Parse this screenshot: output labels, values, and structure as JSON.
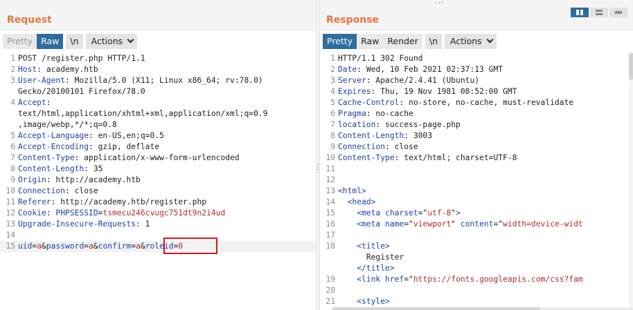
{
  "request": {
    "title": "Request",
    "tabs": {
      "pretty": "Pretty",
      "raw": "Raw",
      "newline": "\\n",
      "actions": "Actions"
    },
    "lines": [
      {
        "n": "1",
        "parts": [
          [
            "POST /register.php HTTP/1.1",
            "plain"
          ]
        ]
      },
      {
        "n": "2",
        "parts": [
          [
            "Host",
            "hk"
          ],
          [
            ": academy.htb",
            "plain"
          ]
        ]
      },
      {
        "n": "3",
        "parts": [
          [
            "User-Agent",
            "hk"
          ],
          [
            ": Mozilla/5.0 (X11; Linux x86_64; rv:78.0)",
            "plain"
          ]
        ]
      },
      {
        "n": "",
        "parts": [
          [
            "Gecko/20100101 Firefox/78.0",
            "plain"
          ]
        ]
      },
      {
        "n": "4",
        "parts": [
          [
            "Accept",
            "hk"
          ],
          [
            ":",
            "plain"
          ]
        ]
      },
      {
        "n": "",
        "parts": [
          [
            "text/html,application/xhtml+xml,application/xml;q=0.9",
            "plain"
          ]
        ]
      },
      {
        "n": "",
        "parts": [
          [
            ",image/webp,*/*;q=0.8",
            "plain"
          ]
        ]
      },
      {
        "n": "5",
        "parts": [
          [
            "Accept-Language",
            "hk"
          ],
          [
            ": en-US,en;q=0.5",
            "plain"
          ]
        ]
      },
      {
        "n": "6",
        "parts": [
          [
            "Accept-Encoding",
            "hk"
          ],
          [
            ": gzip, deflate",
            "plain"
          ]
        ]
      },
      {
        "n": "7",
        "parts": [
          [
            "Content-Type",
            "hk"
          ],
          [
            ": application/x-www-form-urlencoded",
            "plain"
          ]
        ]
      },
      {
        "n": "8",
        "parts": [
          [
            "Content-Length",
            "hk"
          ],
          [
            ": 35",
            "plain"
          ]
        ]
      },
      {
        "n": "9",
        "parts": [
          [
            "Origin",
            "hk"
          ],
          [
            ": http://academy.htb",
            "plain"
          ]
        ]
      },
      {
        "n": "10",
        "parts": [
          [
            "Connection",
            "hk"
          ],
          [
            ": close",
            "plain"
          ]
        ]
      },
      {
        "n": "11",
        "parts": [
          [
            "Referer",
            "hk"
          ],
          [
            ": http://academy.htb/register.php",
            "plain"
          ]
        ]
      },
      {
        "n": "12",
        "parts": [
          [
            "Cookie",
            "hk"
          ],
          [
            ": ",
            "plain"
          ],
          [
            "PHPSESSID",
            "ck"
          ],
          [
            "=",
            "plain"
          ],
          [
            "tsmecu246cvugc751dt9n2i4ud",
            "cv"
          ]
        ]
      },
      {
        "n": "13",
        "parts": [
          [
            "Upgrade-Insecure-Requests",
            "hk"
          ],
          [
            ": 1",
            "plain"
          ]
        ]
      },
      {
        "n": "14",
        "parts": []
      },
      {
        "n": "15",
        "parts": [
          [
            "uid",
            "ck"
          ],
          [
            "=",
            "plain"
          ],
          [
            "a",
            "cv"
          ],
          [
            "&",
            "plain"
          ],
          [
            "password",
            "ck"
          ],
          [
            "=",
            "plain"
          ],
          [
            "a",
            "cv"
          ],
          [
            "&",
            "plain"
          ],
          [
            "confirm",
            "ck"
          ],
          [
            "=",
            "plain"
          ],
          [
            "a",
            "cv"
          ],
          [
            "&",
            "plain"
          ],
          [
            "roleid",
            "ck"
          ],
          [
            "=",
            "plain"
          ],
          [
            "0",
            "cv"
          ]
        ],
        "highlight": true
      }
    ]
  },
  "response": {
    "title": "Response",
    "tabs": {
      "pretty": "Pretty",
      "raw": "Raw",
      "render": "Render",
      "newline": "\\n",
      "actions": "Actions"
    },
    "lines": [
      {
        "n": "1",
        "parts": [
          [
            "HTTP/1.1 302 Found",
            "plain"
          ]
        ]
      },
      {
        "n": "2",
        "parts": [
          [
            "Date",
            "hk"
          ],
          [
            ": Wed, 10 Feb 2021 02:37:13 GMT",
            "plain"
          ]
        ]
      },
      {
        "n": "3",
        "parts": [
          [
            "Server",
            "hk"
          ],
          [
            ": Apache/2.4.41 (Ubuntu)",
            "plain"
          ]
        ]
      },
      {
        "n": "4",
        "parts": [
          [
            "Expires",
            "hk"
          ],
          [
            ": Thu, 19 Nov 1981 08:52:00 GMT",
            "plain"
          ]
        ]
      },
      {
        "n": "5",
        "parts": [
          [
            "Cache-Control",
            "hk"
          ],
          [
            ": no-store, no-cache, must-revalidate",
            "plain"
          ]
        ]
      },
      {
        "n": "6",
        "parts": [
          [
            "Pragma",
            "hk"
          ],
          [
            ": no-cache",
            "plain"
          ]
        ]
      },
      {
        "n": "7",
        "parts": [
          [
            "location",
            "hk"
          ],
          [
            ": success-page.php",
            "plain"
          ]
        ]
      },
      {
        "n": "8",
        "parts": [
          [
            "Content-Length",
            "hk"
          ],
          [
            ": 3003",
            "plain"
          ]
        ]
      },
      {
        "n": "9",
        "parts": [
          [
            "Connection",
            "hk"
          ],
          [
            ": close",
            "plain"
          ]
        ]
      },
      {
        "n": "10",
        "parts": [
          [
            "Content-Type",
            "hk"
          ],
          [
            ": text/html; charset=UTF-8",
            "plain"
          ]
        ]
      },
      {
        "n": "11",
        "parts": []
      },
      {
        "n": "12",
        "parts": []
      },
      {
        "n": "13",
        "parts": [
          [
            "<html>",
            "tag"
          ]
        ]
      },
      {
        "n": "14",
        "parts": [
          [
            "  ",
            "plain"
          ],
          [
            "<head>",
            "tag"
          ]
        ]
      },
      {
        "n": "15",
        "parts": [
          [
            "    ",
            "plain"
          ],
          [
            "<meta ",
            "tag"
          ],
          [
            "charset",
            "attr"
          ],
          [
            "=\"",
            "plain"
          ],
          [
            "utf-8",
            "aval"
          ],
          [
            "\"",
            "plain"
          ],
          [
            ">",
            "tag"
          ]
        ]
      },
      {
        "n": "16",
        "parts": [
          [
            "    ",
            "plain"
          ],
          [
            "<meta ",
            "tag"
          ],
          [
            "name",
            "attr"
          ],
          [
            "=\"",
            "plain"
          ],
          [
            "viewport",
            "aval"
          ],
          [
            "\" ",
            "plain"
          ],
          [
            "content",
            "attr"
          ],
          [
            "=\"",
            "plain"
          ],
          [
            "width=device-widt",
            "aval"
          ]
        ]
      },
      {
        "n": "17",
        "parts": []
      },
      {
        "n": "18",
        "parts": [
          [
            "    ",
            "plain"
          ],
          [
            "<title>",
            "tag"
          ]
        ]
      },
      {
        "n": "",
        "parts": [
          [
            "      Register",
            "plain"
          ]
        ]
      },
      {
        "n": "",
        "parts": [
          [
            "    ",
            "plain"
          ],
          [
            "</title>",
            "tag"
          ]
        ]
      },
      {
        "n": "19",
        "parts": [
          [
            "    ",
            "plain"
          ],
          [
            "<link ",
            "tag"
          ],
          [
            "href",
            "attr"
          ],
          [
            "=\"",
            "plain"
          ],
          [
            "https://fonts.googleapis.com/css?fam",
            "aval"
          ]
        ]
      },
      {
        "n": "20",
        "parts": []
      },
      {
        "n": "21",
        "parts": [
          [
            "    ",
            "plain"
          ],
          [
            "<style>",
            "tag"
          ]
        ]
      }
    ]
  },
  "colors": {
    "title_accent": "#e8743b",
    "active_tab": "#2e6d9e",
    "highlight_box": "#d7141c"
  },
  "icons": {
    "layout_side_by_side": "columns-icon",
    "layout_stacked": "rows-icon",
    "layout_single": "single-pane-icon"
  }
}
